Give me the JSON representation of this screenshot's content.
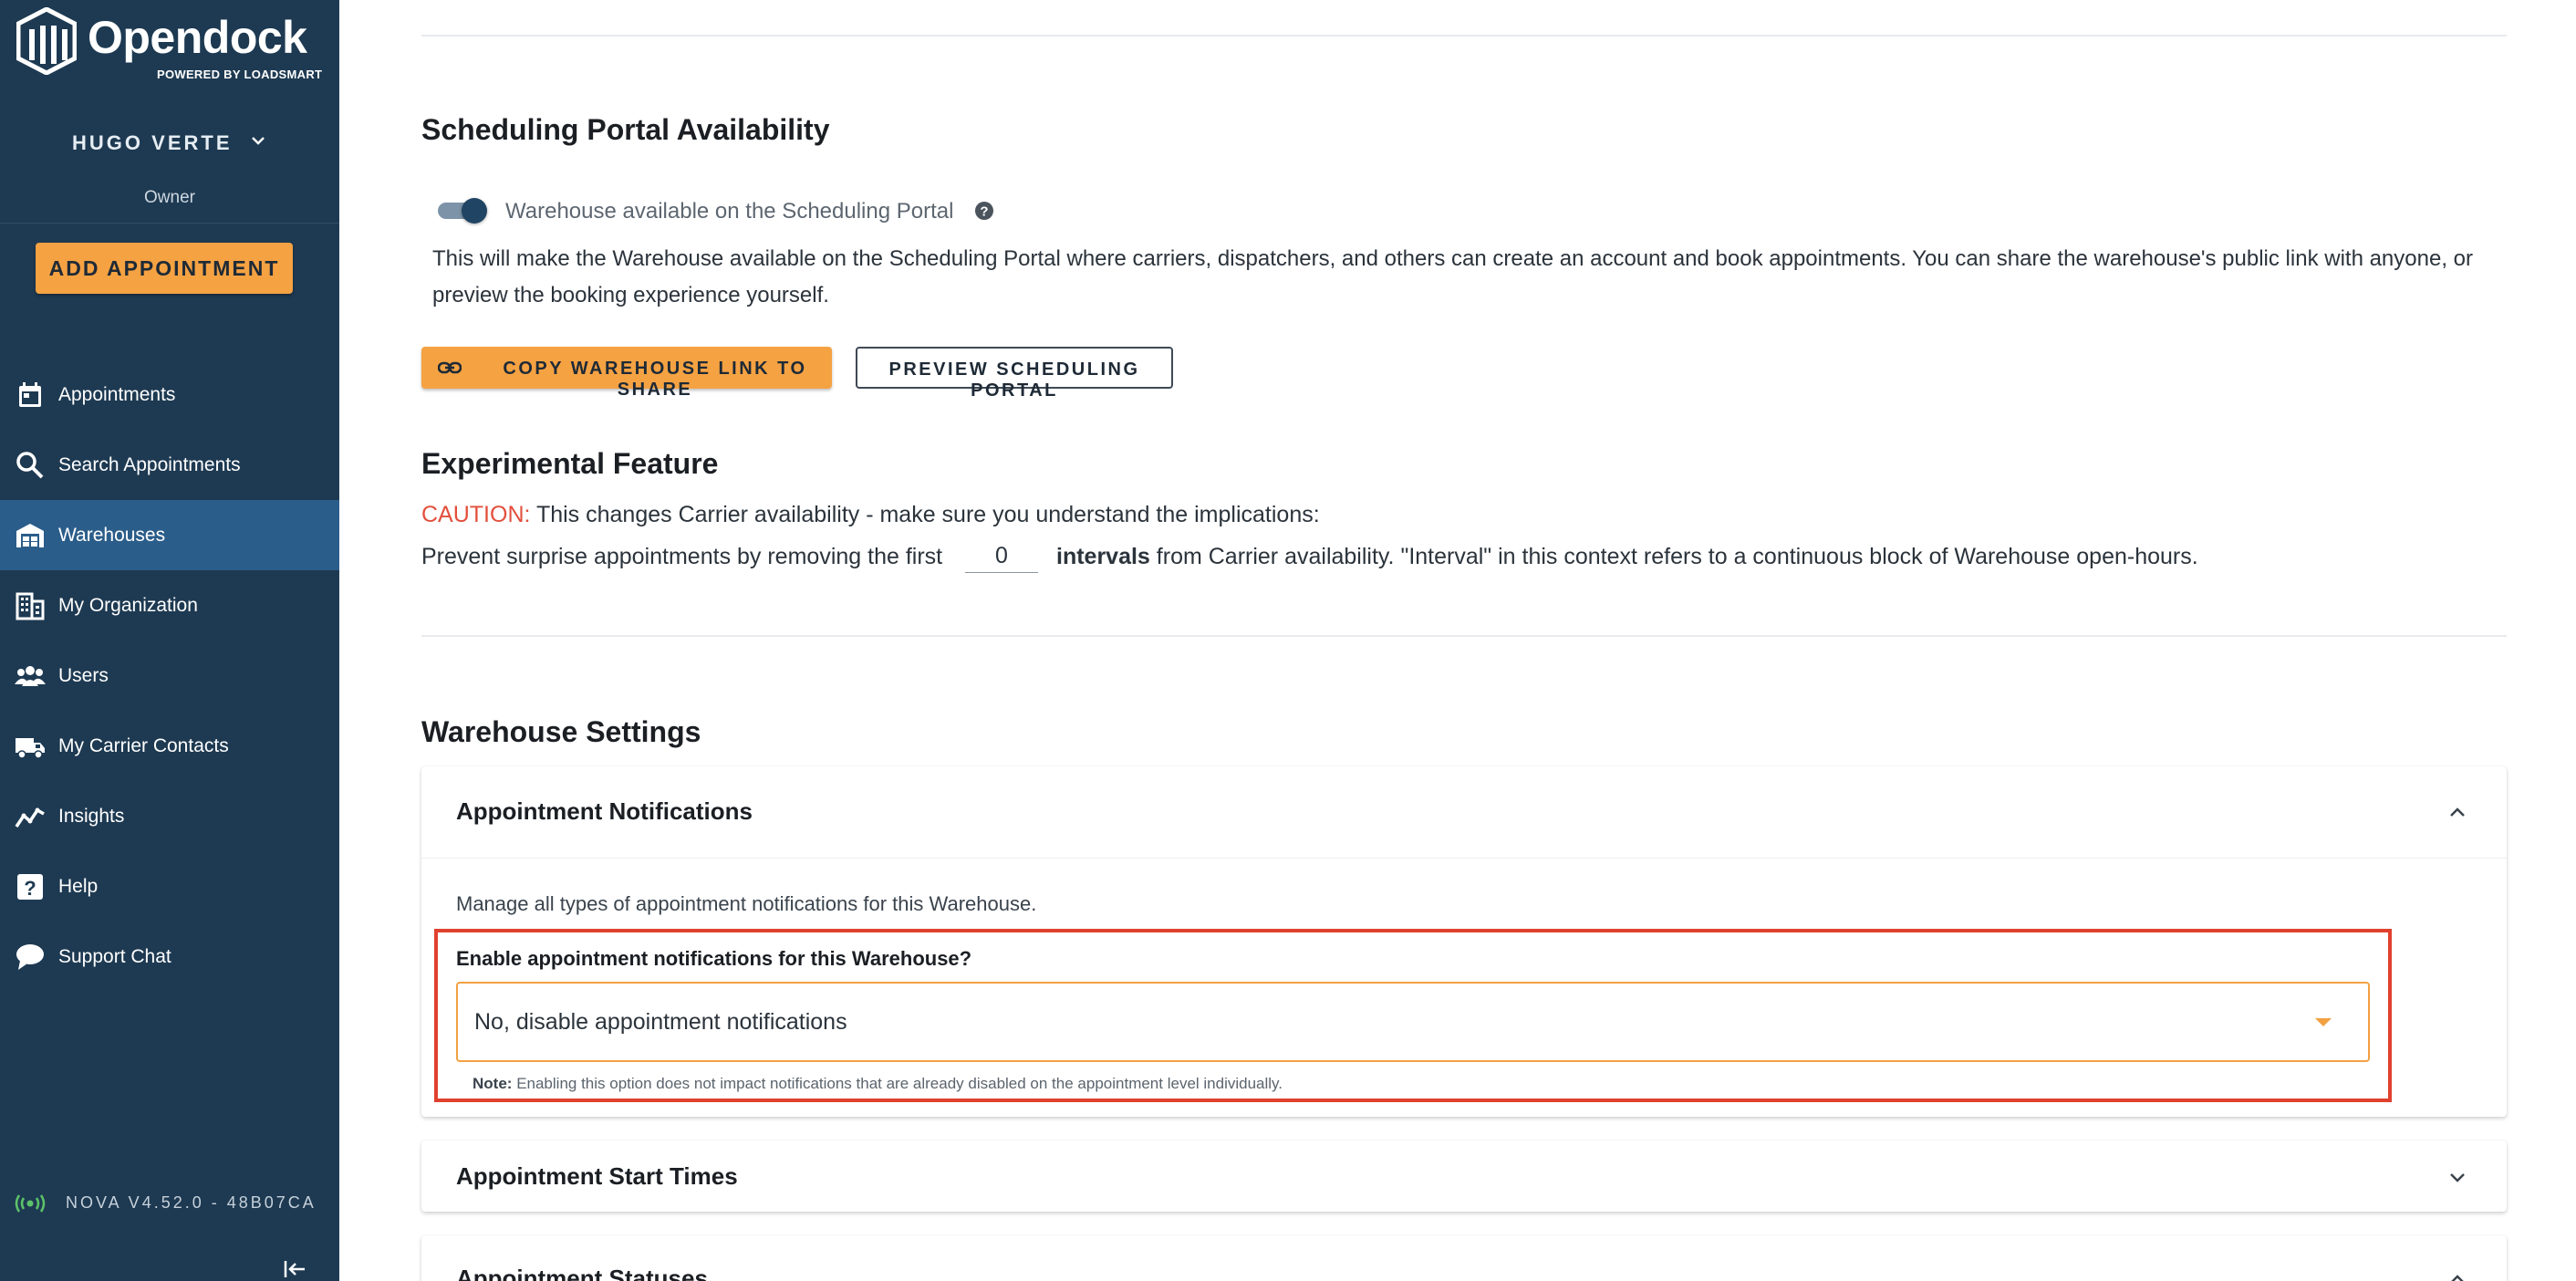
{
  "sidebar": {
    "brand": {
      "name": "Opendock",
      "tagline": "POWERED BY LOADSMART"
    },
    "user": {
      "name": "HUGO VERTE",
      "role": "Owner"
    },
    "add_button": "ADD APPOINTMENT",
    "items": [
      {
        "label": "Appointments",
        "icon": "calendar-icon"
      },
      {
        "label": "Search Appointments",
        "icon": "search-icon"
      },
      {
        "label": "Warehouses",
        "icon": "warehouse-icon",
        "active": true
      },
      {
        "label": "My Organization",
        "icon": "building-icon"
      },
      {
        "label": "Users",
        "icon": "users-icon"
      },
      {
        "label": "My Carrier Contacts",
        "icon": "truck-icon"
      },
      {
        "label": "Insights",
        "icon": "chart-line-icon"
      },
      {
        "label": "Help",
        "icon": "help-icon"
      },
      {
        "label": "Support Chat",
        "icon": "chat-icon"
      }
    ],
    "version": "NOVA V4.52.0 - 48B07CA"
  },
  "scheduling": {
    "title": "Scheduling Portal Availability",
    "toggle_label": "Warehouse available on the Scheduling Portal",
    "toggle_on": true,
    "description": "This will make the Warehouse available on the Scheduling Portal where carriers, dispatchers, and others can create an account and book appointments. You can share the warehouse's public link with anyone, or preview the booking experience yourself.",
    "copy_button": "COPY WAREHOUSE LINK TO SHARE",
    "preview_button": "PREVIEW SCHEDULING PORTAL"
  },
  "experimental": {
    "title": "Experimental Feature",
    "caution_label": "CAUTION:",
    "caution_text": "This changes Carrier availability - make sure you understand the implications:",
    "interval_prefix": "Prevent surprise appointments by removing the first",
    "interval_value": "0",
    "interval_bold": "intervals",
    "interval_suffix": "from Carrier availability. \"Interval\" in this context refers to a continuous block of Warehouse open-hours."
  },
  "settings": {
    "title": "Warehouse Settings",
    "notifications": {
      "title": "Appointment Notifications",
      "description": "Manage all types of appointment notifications for this Warehouse.",
      "question": "Enable appointment notifications for this Warehouse?",
      "selected": "No, disable appointment notifications",
      "note_label": "Note:",
      "note_text": "Enabling this option does not impact notifications that are already disabled on the appointment level individually."
    },
    "start_times": {
      "title": "Appointment Start Times"
    },
    "statuses": {
      "title": "Appointment Statuses"
    }
  },
  "colors": {
    "sidebar_bg": "#1e3a52",
    "sidebar_active": "#2b5d8a",
    "accent_orange": "#f5a243",
    "caution_red": "#e24f3c",
    "highlight_red": "#e0412e"
  }
}
